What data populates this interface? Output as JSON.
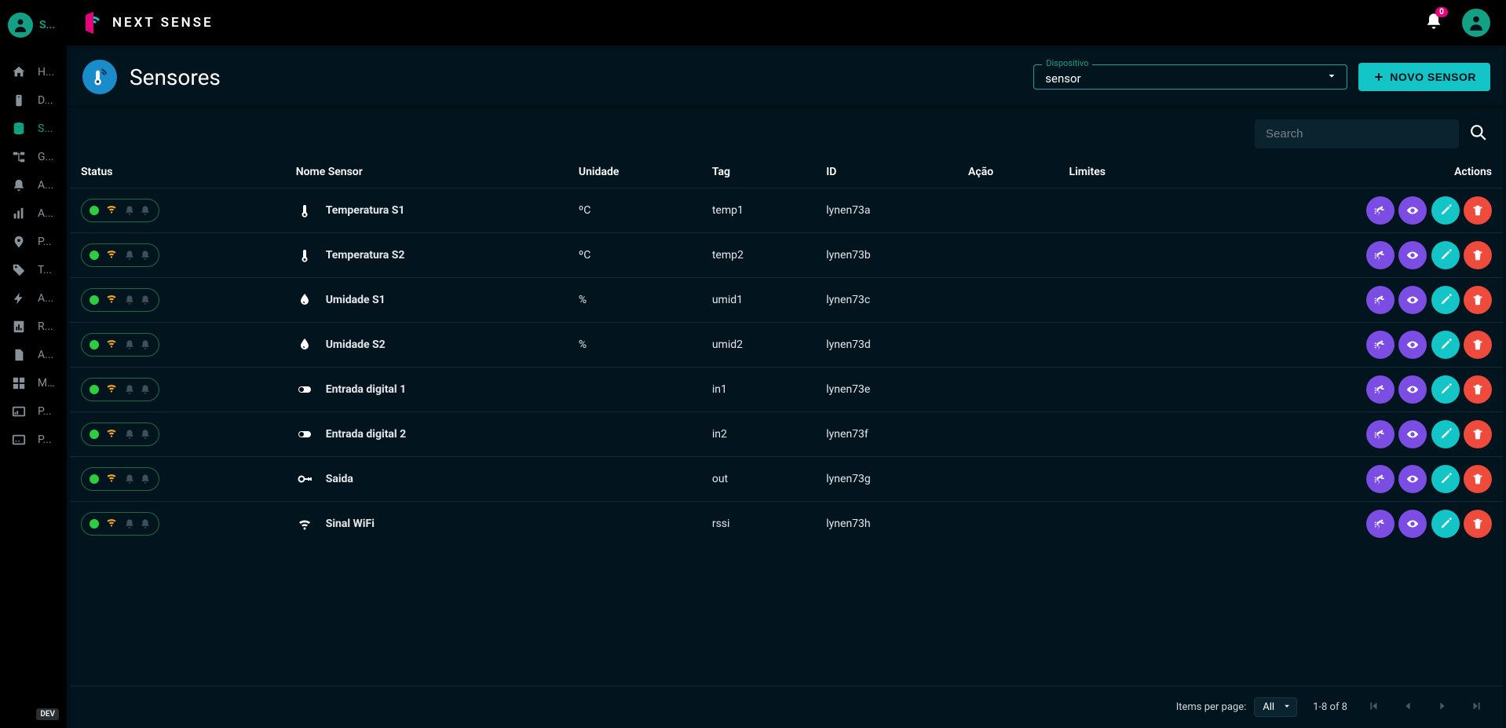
{
  "brand": {
    "name": "NEXT SENSE"
  },
  "sidebar": {
    "user_label": "S...",
    "items": [
      {
        "label": "H...",
        "icon": "home"
      },
      {
        "label": "D...",
        "icon": "device"
      },
      {
        "label": "S...",
        "icon": "database",
        "active": true
      },
      {
        "label": "G...",
        "icon": "tree"
      },
      {
        "label": "A...",
        "icon": "bell"
      },
      {
        "label": "A...",
        "icon": "chart"
      },
      {
        "label": "P...",
        "icon": "pin"
      },
      {
        "label": "T...",
        "icon": "tag"
      },
      {
        "label": "A...",
        "icon": "bolt"
      },
      {
        "label": "R...",
        "icon": "report"
      },
      {
        "label": "A...",
        "icon": "file"
      },
      {
        "label": "M...",
        "icon": "grid"
      },
      {
        "label": "P...",
        "icon": "panel-a"
      },
      {
        "label": "P...",
        "icon": "panel-b"
      }
    ],
    "dev_badge": "DEV"
  },
  "topbar": {
    "notifications": "0"
  },
  "header": {
    "title": "Sensores",
    "device_label": "Dispositivo",
    "device_value": "sensor",
    "new_button": "NOVO SENSOR"
  },
  "search": {
    "placeholder": "Search"
  },
  "table": {
    "columns": {
      "status": "Status",
      "name": "Nome Sensor",
      "unit": "Unidade",
      "tag": "Tag",
      "id": "ID",
      "action": "Ação",
      "limits": "Limites",
      "actions": "Actions"
    },
    "rows": [
      {
        "icon": "thermometer",
        "name": "Temperatura S1",
        "unit": "ºC",
        "tag": "temp1",
        "id": "lynen73a"
      },
      {
        "icon": "thermometer",
        "name": "Temperatura S2",
        "unit": "ºC",
        "tag": "temp2",
        "id": "lynen73b"
      },
      {
        "icon": "droplet",
        "name": "Umidade S1",
        "unit": "%",
        "tag": "umid1",
        "id": "lynen73c"
      },
      {
        "icon": "droplet",
        "name": "Umidade S2",
        "unit": "%",
        "tag": "umid2",
        "id": "lynen73d"
      },
      {
        "icon": "toggle",
        "name": "Entrada digital 1",
        "unit": "",
        "tag": "in1",
        "id": "lynen73e"
      },
      {
        "icon": "toggle",
        "name": "Entrada digital 2",
        "unit": "",
        "tag": "in2",
        "id": "lynen73f"
      },
      {
        "icon": "key",
        "name": "Saida",
        "unit": "",
        "tag": "out",
        "id": "lynen73g"
      },
      {
        "icon": "wifi",
        "name": "Sinal WiFi",
        "unit": "",
        "tag": "rssi",
        "id": "lynen73h"
      }
    ]
  },
  "paginator": {
    "items_label": "Items per page:",
    "page_size": "All",
    "range": "1-8 of 8"
  }
}
